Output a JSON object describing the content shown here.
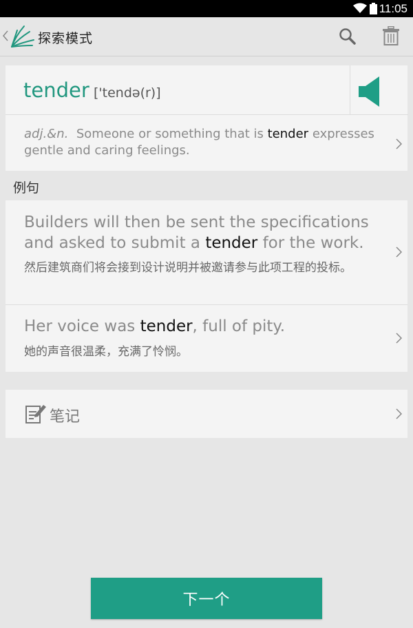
{
  "status_bar": {
    "time": "11:05"
  },
  "action_bar": {
    "title": "探索模式"
  },
  "word_card": {
    "word": "tender",
    "phonetic": "['tendə(r)]",
    "definition": {
      "pos": "adj.&n.",
      "text_before": "Someone or something that is",
      "highlight": "tender",
      "text_after": "expresses gentle and caring feelings."
    }
  },
  "examples": {
    "section_label": "例句",
    "items": [
      {
        "en_before": "Builders will then be sent the specifications and asked to submit a",
        "highlight": "tender",
        "en_after": "for the work.",
        "zh": "然后建筑商们将会接到设计说明并被邀请参与此项工程的投标。"
      },
      {
        "en_before": "Her voice was",
        "highlight": "tender",
        "en_after": ", full of pity.",
        "zh": "她的声音很温柔，充满了怜悯。"
      }
    ]
  },
  "note": {
    "label": "笔记"
  },
  "next_button": {
    "label": "下一个"
  },
  "colors": {
    "accent": "#1f9e86",
    "word": "#21977f"
  }
}
